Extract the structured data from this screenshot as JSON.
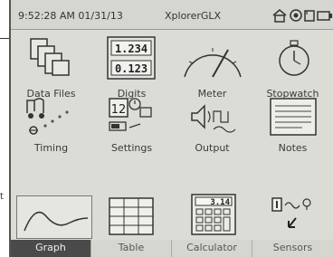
{
  "status": {
    "time_date": "9:52:28 AM 01/31/13",
    "title": "XplorerGLX"
  },
  "apps": [
    {
      "label": "Data Files",
      "icon": "data-files-icon"
    },
    {
      "label": "Digits",
      "icon": "digits-icon",
      "readouts": [
        "1.234",
        "0.123"
      ]
    },
    {
      "label": "Meter",
      "icon": "meter-icon"
    },
    {
      "label": "Stopwatch",
      "icon": "stopwatch-icon"
    },
    {
      "label": "Timing",
      "icon": "timing-icon"
    },
    {
      "label": "Settings",
      "icon": "settings-icon",
      "calendar_day": "12"
    },
    {
      "label": "Output",
      "icon": "output-icon"
    },
    {
      "label": "Notes",
      "icon": "notes-icon"
    },
    {
      "label": "Graph",
      "icon": "graph-icon"
    },
    {
      "label": "Table",
      "icon": "table-icon"
    },
    {
      "label": "Calculator",
      "icon": "calculator-icon",
      "display": "3.14"
    },
    {
      "label": "Sensors",
      "icon": "sensors-icon"
    }
  ],
  "selected_app": "Graph",
  "side_text": "t"
}
